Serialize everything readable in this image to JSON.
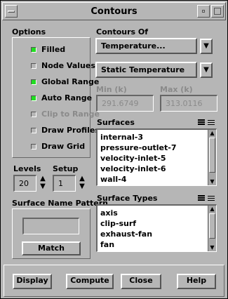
{
  "window": {
    "title": "Contours"
  },
  "options": {
    "header": "Options",
    "items": [
      {
        "label": "Filled",
        "checked": true,
        "enabled": true
      },
      {
        "label": "Node Values",
        "checked": false,
        "enabled": true
      },
      {
        "label": "Global Range",
        "checked": true,
        "enabled": true
      },
      {
        "label": "Auto Range",
        "checked": true,
        "enabled": true
      },
      {
        "label": "Clip to Range",
        "checked": false,
        "enabled": false
      },
      {
        "label": "Draw Profiles",
        "checked": false,
        "enabled": true
      },
      {
        "label": "Draw Grid",
        "checked": false,
        "enabled": true
      }
    ]
  },
  "levels": {
    "label": "Levels",
    "value": "20"
  },
  "setup": {
    "label": "Setup",
    "value": "1"
  },
  "pattern": {
    "header": "Surface Name Pattern",
    "value": "",
    "match_label": "Match"
  },
  "contours_of": {
    "header": "Contours Of",
    "category": "Temperature...",
    "variable": "Static Temperature",
    "min_label": "Min (k)",
    "min_value": "291.6749",
    "max_label": "Max (k)",
    "max_value": "313.0116"
  },
  "surfaces": {
    "header": "Surfaces",
    "items": [
      "internal-3",
      "pressure-outlet-7",
      "velocity-inlet-5",
      "velocity-inlet-6",
      "wall-4"
    ]
  },
  "surface_types": {
    "header": "Surface Types",
    "items": [
      "axis",
      "clip-surf",
      "exhaust-fan",
      "fan"
    ]
  },
  "buttons": {
    "display": "Display",
    "compute": "Compute",
    "close": "Close",
    "help": "Help"
  },
  "colors": {
    "checked": "#22dd22",
    "background": "#b6b6b6"
  }
}
